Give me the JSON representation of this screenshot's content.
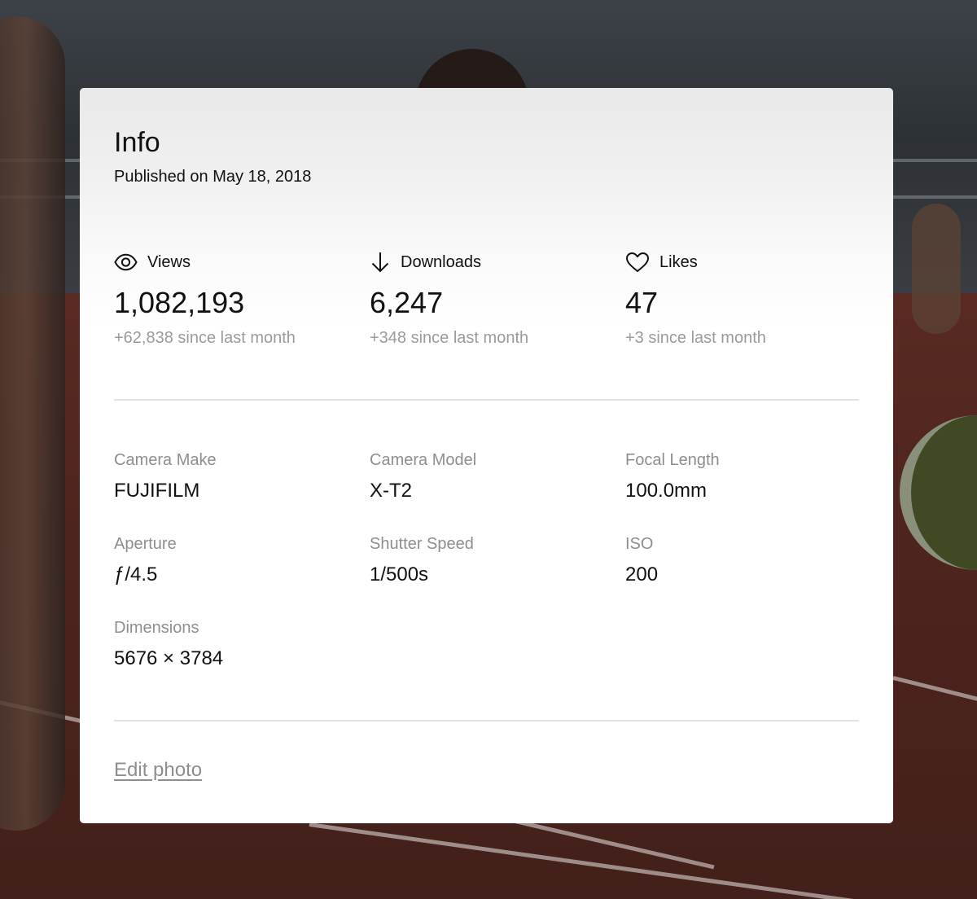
{
  "info": {
    "title": "Info",
    "published": "Published on May 18, 2018"
  },
  "stats": [
    {
      "icon": "eye-icon",
      "label": "Views",
      "value": "1,082,193",
      "delta": "+62,838 since last month"
    },
    {
      "icon": "arrow-down-icon",
      "label": "Downloads",
      "value": "6,247",
      "delta": "+348 since last month"
    },
    {
      "icon": "heart-icon",
      "label": "Likes",
      "value": "47",
      "delta": "+3 since last month"
    }
  ],
  "exif": {
    "camera_make": {
      "label": "Camera Make",
      "value": "FUJIFILM"
    },
    "camera_model": {
      "label": "Camera Model",
      "value": "X-T2"
    },
    "focal_length": {
      "label": "Focal Length",
      "value": "100.0mm"
    },
    "aperture": {
      "label": "Aperture",
      "value": "ƒ/4.5"
    },
    "shutter_speed": {
      "label": "Shutter Speed",
      "value": "1/500s"
    },
    "iso": {
      "label": "ISO",
      "value": "200"
    },
    "dimensions": {
      "label": "Dimensions",
      "value": "5676 × 3784"
    }
  },
  "actions": {
    "edit_photo": "Edit photo"
  },
  "colors": {
    "text_primary": "#111111",
    "text_secondary": "#9b9b9b",
    "divider": "#e4e4e4",
    "card_bg": "#ffffff"
  }
}
